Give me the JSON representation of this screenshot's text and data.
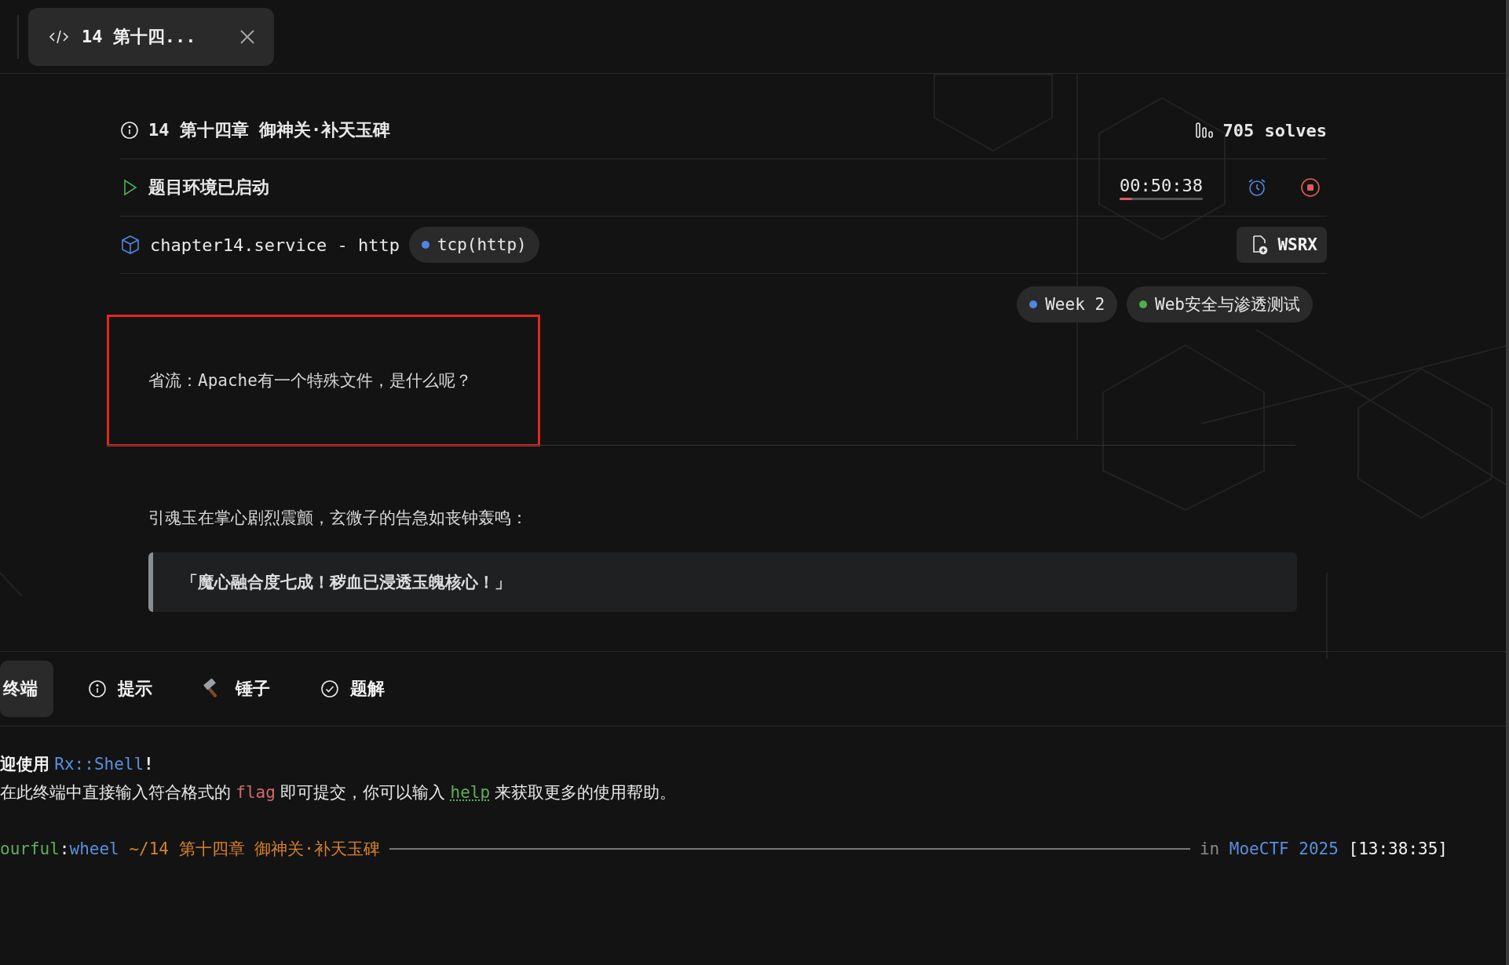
{
  "tab": {
    "label": "14 第十四...",
    "selected": true
  },
  "challenge": {
    "title": "14 第十四章 御神关·补天玉碑",
    "solves": "705 solves",
    "status": "题目环境已启动",
    "timer": {
      "text": "00:50:38",
      "level": 0.15
    },
    "service": "chapter14.service - http",
    "protocol": "tcp(http)",
    "button": "WSRX"
  },
  "tags": [
    {
      "label": "Week 2",
      "color": "#4f86e0"
    },
    {
      "label": "Web安全与渗透测试",
      "color": "#4caf50"
    }
  ],
  "hint": {
    "text": "省流：Apache有一个特殊文件，是什么呢？",
    "highlighted": true
  },
  "paragraph": "引魂玉在掌心剧烈震颤，玄微子的告急如丧钟轰鸣：",
  "quote": "「魔心融合度七成！秽血已浸透玉魄核心！」",
  "panel_tabs": [
    {
      "label": "终端",
      "kind": "none",
      "selected": true
    },
    {
      "label": "提示",
      "kind": "info",
      "selected": false
    },
    {
      "label": "锤子",
      "kind": "hammer",
      "selected": false
    },
    {
      "label": "题解",
      "kind": "check",
      "selected": false
    }
  ],
  "terminal": {
    "lines": [
      {
        "kind": "text",
        "segments": [
          {
            "kind": "strong",
            "text": "迎使用"
          },
          {
            "kind": "accent",
            "text": "Rx::Shell"
          },
          {
            "kind": "strong",
            "text": "!"
          }
        ]
      },
      {
        "kind": "text",
        "segments": [
          {
            "kind": "plain",
            "text": "在此终端中直接输入符合格式的"
          },
          {
            "kind": "flag",
            "text": "flag"
          },
          {
            "kind": "plain",
            "text": "即可提交，你可以输入"
          },
          {
            "kind": "link",
            "text": "help"
          },
          {
            "kind": "plain",
            "text": "来获取更多的使用帮助。"
          }
        ]
      },
      {
        "kind": "prompt",
        "user": "ourful",
        "separator": ":",
        "host": "wheel",
        "path": "~/14 第十四章 御神关·补天玉碑",
        "preposition": "in",
        "project": "MoeCTF 2025",
        "time": "[13:38:35]"
      }
    ]
  }
}
